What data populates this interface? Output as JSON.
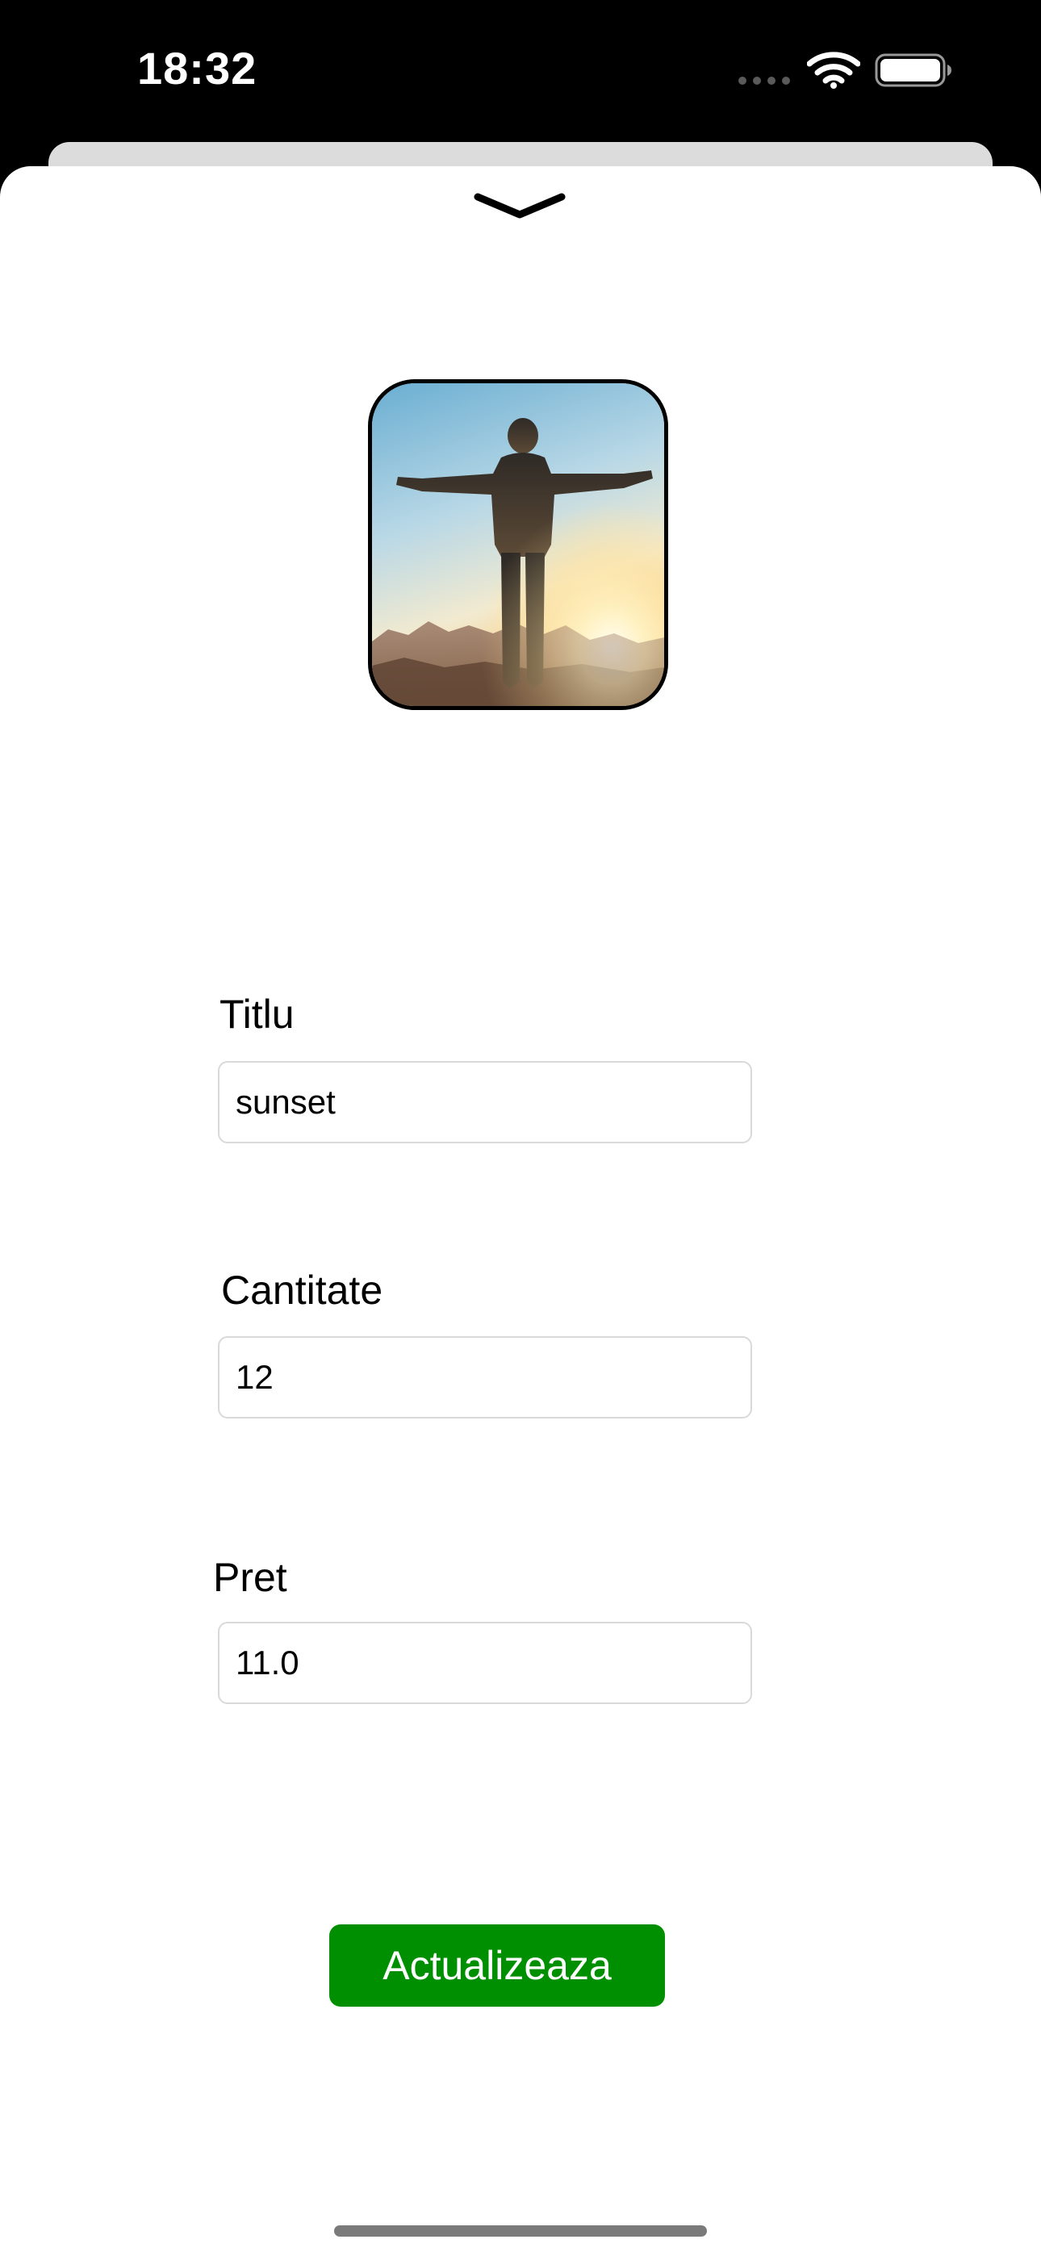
{
  "status_bar": {
    "time": "18:32",
    "icons": [
      "signal-dots-icon",
      "wifi-icon",
      "battery-icon"
    ]
  },
  "sheet": {
    "dismiss_icon": "chevron-down-icon",
    "image_alt": "person with arms outstretched at sunset"
  },
  "form": {
    "title_label": "Titlu",
    "title_value": "sunset",
    "quantity_label": "Cantitate",
    "quantity_value": "12",
    "price_label": "Pret",
    "price_value": "11.0",
    "submit_label": "Actualizeaza"
  },
  "colors": {
    "button_bg": "#008f00",
    "button_text": "#ffffff",
    "field_border": "#d9d9d9"
  }
}
